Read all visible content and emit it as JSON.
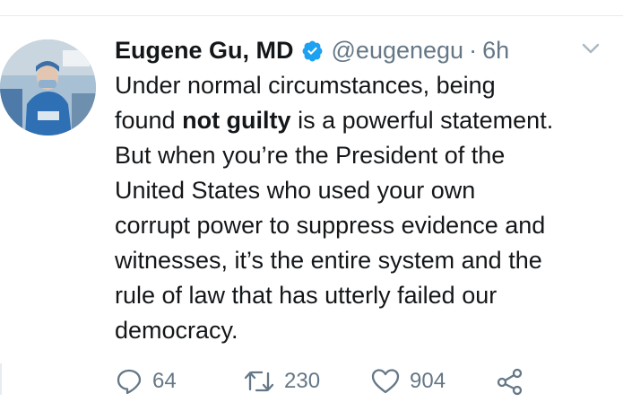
{
  "tweet": {
    "author_name": "Eugene Gu, MD",
    "handle": "@eugenegu",
    "separator": "·",
    "time": "6h",
    "lines": [
      {
        "pre": "Under normal circumstances, being",
        "bold": "",
        "post": ""
      },
      {
        "pre": "found ",
        "bold": "not guilty",
        "post": " is a powerful statement."
      },
      {
        "pre": "But when you’re the President of the",
        "bold": "",
        "post": ""
      },
      {
        "pre": "United States who used your own",
        "bold": "",
        "post": ""
      },
      {
        "pre": "corrupt power to suppress evidence and",
        "bold": "",
        "post": ""
      },
      {
        "pre": "witnesses, it’s the entire system and the",
        "bold": "",
        "post": ""
      },
      {
        "pre": "rule of law that has utterly failed our",
        "bold": "",
        "post": ""
      },
      {
        "pre": "democracy.",
        "bold": "",
        "post": ""
      }
    ],
    "reply_count": "64",
    "retweet_count": "230",
    "like_count": "904"
  },
  "icons": {
    "verified": "verified-badge-icon",
    "menu": "chevron-down-icon",
    "reply": "reply-icon",
    "retweet": "retweet-icon",
    "like": "heart-icon",
    "share": "share-icon"
  },
  "colors": {
    "text": "#14171a",
    "secondary": "#657786",
    "verified": "#1da1f2",
    "divider": "#e6ecf0"
  }
}
